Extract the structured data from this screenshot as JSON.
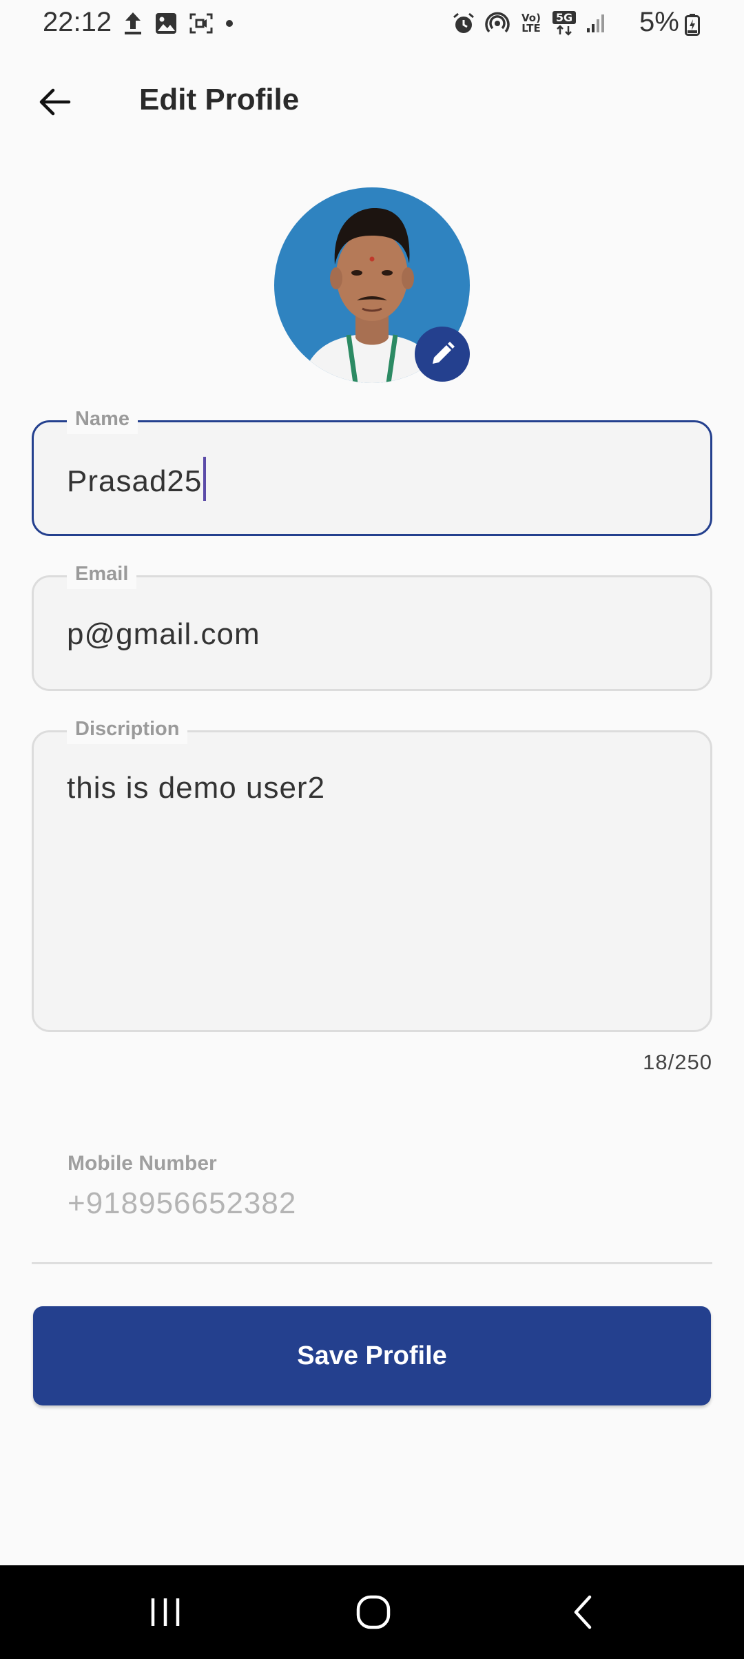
{
  "status_bar": {
    "time": "22:12",
    "battery": "5%",
    "icons_left": [
      "upload-icon",
      "image-icon",
      "screen-record-icon",
      "dot-icon"
    ],
    "icons_right": [
      "alarm-icon",
      "hotspot-icon",
      "volte-icon",
      "5g-icon",
      "signal-icon",
      "battery-icon"
    ],
    "volte_label": "Vo) LTE",
    "network_label": "5G"
  },
  "app_bar": {
    "title": "Edit Profile",
    "back_icon": "arrow-left-icon"
  },
  "avatar": {
    "edit_icon": "pencil-icon",
    "accent": "#24408e"
  },
  "form": {
    "name": {
      "label": "Name",
      "value": "Prasad25"
    },
    "email": {
      "label": "Email",
      "value": "p@gmail.com"
    },
    "description": {
      "label": "Discription",
      "value": "this is demo user2",
      "counter": "18/250"
    },
    "mobile": {
      "label": "Mobile Number",
      "value": "+918956652382"
    }
  },
  "save_button": {
    "label": "Save Profile"
  },
  "nav_bar": {
    "buttons": [
      "recent-apps-icon",
      "home-icon",
      "back-icon"
    ]
  },
  "colors": {
    "primary": "#24408e",
    "background": "#fafafa",
    "field_fill": "#f4f4f4",
    "cursor": "#5b4ba8"
  }
}
